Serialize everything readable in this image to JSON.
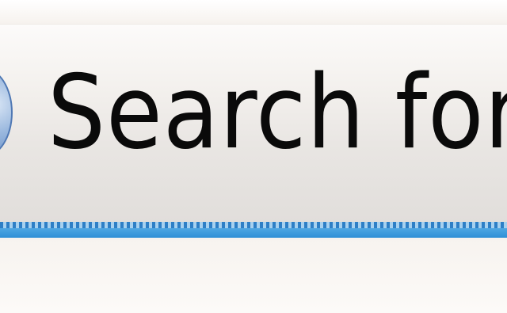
{
  "menu": {
    "item_label": "Search for Upd",
    "icon": "update-globe-icon"
  },
  "colors": {
    "background": "#fbf8f5",
    "text": "#0a0a0a",
    "focus_line": "#2e7fc6",
    "focus_line_light": "#a7d1ef"
  }
}
